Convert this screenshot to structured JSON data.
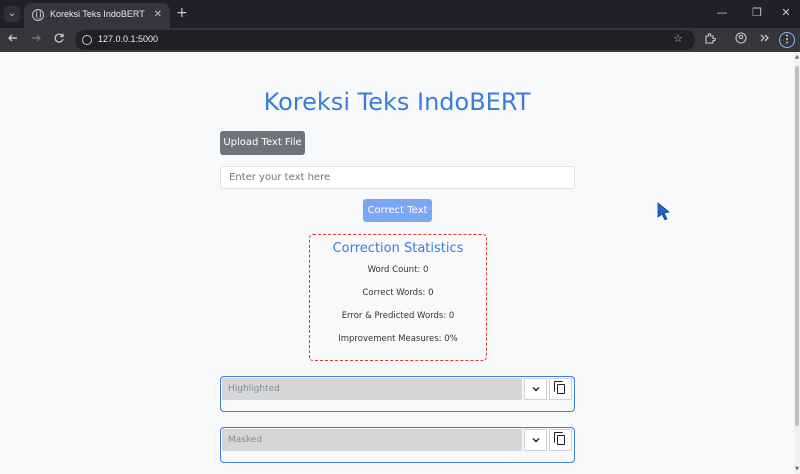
{
  "browser": {
    "tab_title": "Koreksi Teks IndoBERT",
    "tab_close": "✕",
    "new_tab": "+",
    "url": "127.0.0.1:5000",
    "window_controls": {
      "minimize": "—",
      "restore": "❐",
      "close": "✕"
    },
    "icons": {
      "tab_search": "chevron-down-icon",
      "back": "arrow-left-icon",
      "forward": "arrow-right-icon",
      "reload": "reload-icon",
      "site_info": "tune-icon",
      "bookmark": "star-icon",
      "extensions": "puzzle-icon",
      "profile": "profile-icon",
      "more_tools": "double-chevron-icon",
      "menu": "kebab-icon"
    }
  },
  "page": {
    "title": "Koreksi Teks IndoBERT",
    "upload_label": "Upload Text File",
    "input_placeholder": "Enter your text here",
    "correct_label": "Correct Text",
    "stats": {
      "title": "Correction Statistics",
      "word_count": "Word Count: 0",
      "correct_words": "Correct Words: 0",
      "error_words": "Error & Predicted Words: 0",
      "improvement": "Improvement Measures: 0%"
    },
    "panels": [
      {
        "placeholder": "Highlighted"
      },
      {
        "placeholder": "Masked"
      }
    ],
    "colors": {
      "accent": "#3b7dd8",
      "stats_border": "#d9382f",
      "button_secondary": "#6c757d",
      "button_primary": "#7aa7f3"
    }
  }
}
